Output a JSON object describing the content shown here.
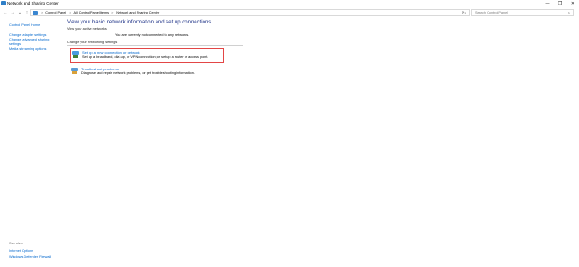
{
  "window": {
    "title": "Network and Sharing Center",
    "controls": [
      "—",
      "❐",
      "✕"
    ]
  },
  "nav": {
    "back": "←",
    "forward": "→",
    "recent": "⌄",
    "up": "↑",
    "breadcrumb": [
      "Control Panel",
      "All Control Panel Items",
      "Network and Sharing Center"
    ],
    "separator": ">",
    "dropdown": "⌄",
    "refresh": "↻",
    "search_placeholder": "Search Control Panel",
    "search_icon": "⌕"
  },
  "sidebar": {
    "home": "Control Panel Home",
    "items": [
      "Change adapter settings",
      "Change advanced sharing settings",
      "Media streaming options"
    ]
  },
  "see_also": {
    "title": "See also",
    "items": [
      "Internet Options",
      "Windows Defender Firewall"
    ]
  },
  "main": {
    "title": "View your basic network information and set up connections",
    "active_networks_label": "View your active networks",
    "not_connected": "You are currently not connected to any networks.",
    "change_settings_label": "Change your networking settings",
    "tasks": [
      {
        "link": "Set up a new connection or network",
        "description": "Set up a broadband, dial-up, or VPN connection; or set up a router or access point.",
        "icon": "new-connection-icon"
      },
      {
        "link": "Troubleshoot problems",
        "description": "Diagnose and repair network problems, or get troubleshooting information.",
        "icon": "troubleshoot-icon"
      }
    ]
  },
  "colors": {
    "link": "#0066cc",
    "title": "#1e3287",
    "highlight": "#e34646"
  }
}
